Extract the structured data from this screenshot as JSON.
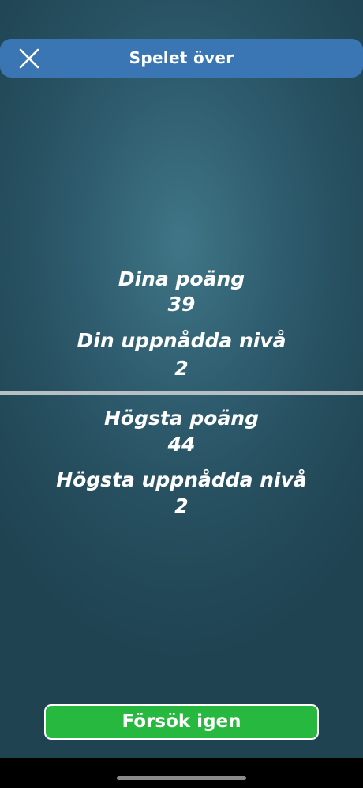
{
  "header": {
    "title": "Spelet över",
    "close_icon": "close-icon"
  },
  "current": {
    "score_label": "Dina poäng",
    "score_value": "39",
    "level_label": "Din uppnådda nivå",
    "level_value": "2"
  },
  "best": {
    "score_label": "Högsta poäng",
    "score_value": "44",
    "level_label": "Högsta uppnådda nivå",
    "level_value": "2"
  },
  "actions": {
    "retry_label": "Försök igen"
  },
  "colors": {
    "header_bg": "#3a76b4",
    "retry_bg": "#27b83f",
    "background": "#2b5969"
  }
}
